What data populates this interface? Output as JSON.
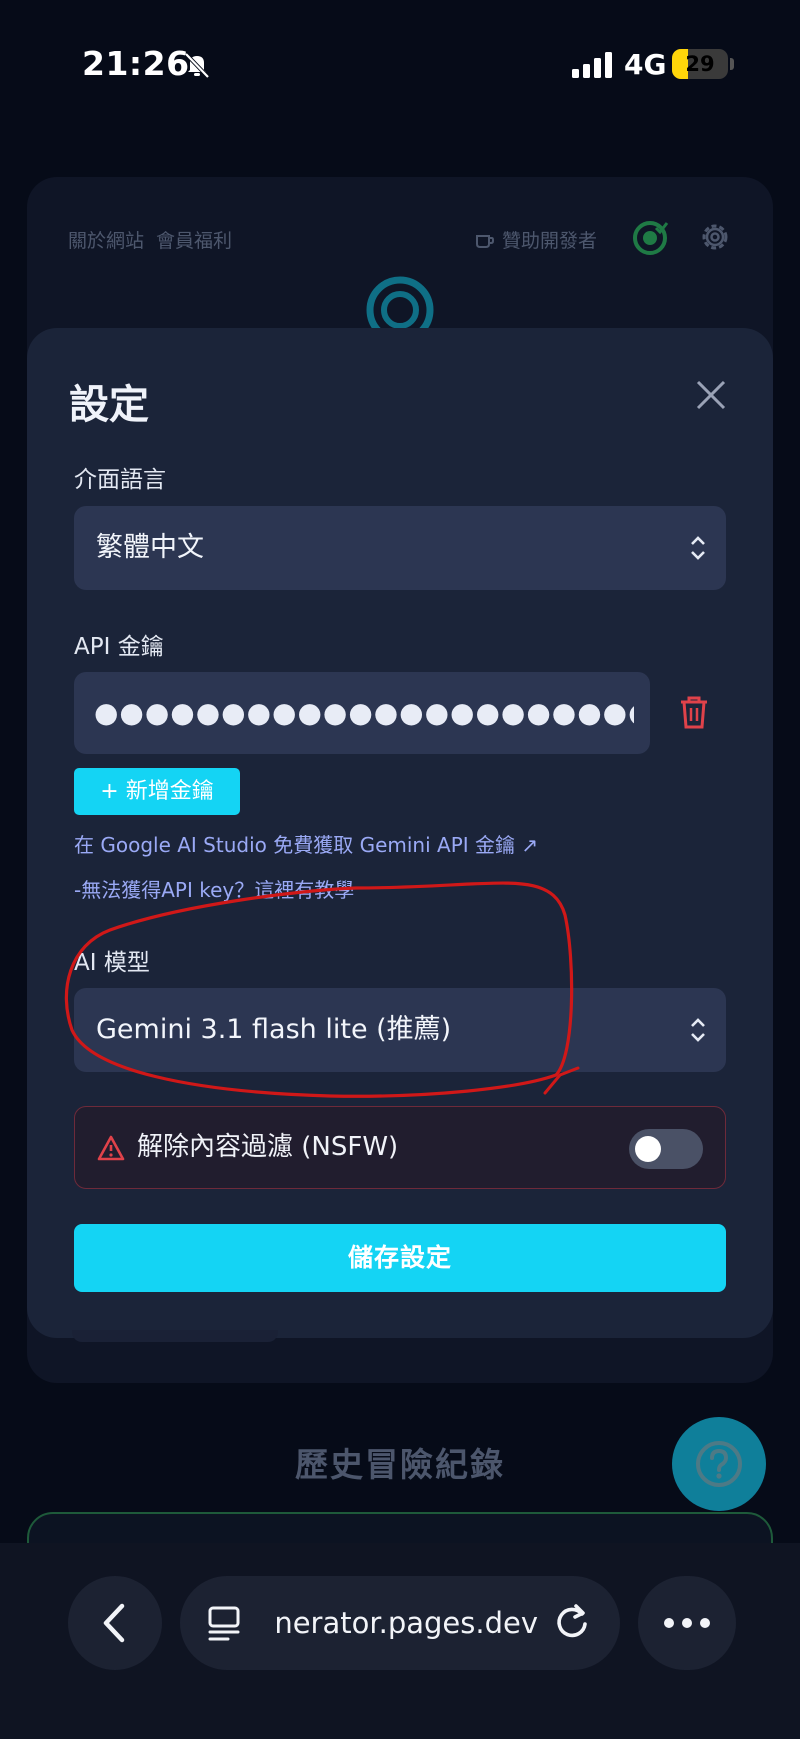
{
  "status_bar": {
    "time": "21:26",
    "network": "4G",
    "battery_level": "29",
    "battery_fraction": 0.29,
    "icons": [
      "bell-off-icon",
      "signal-icon"
    ]
  },
  "background_page": {
    "nav_links": [
      "關於網站",
      "會員福利"
    ],
    "sponsor_label": "贊助開發者",
    "history_title": "歷史冒險紀錄"
  },
  "settings": {
    "title": "設定",
    "language": {
      "label": "介面語言",
      "value": "繁體中文"
    },
    "api_key": {
      "label": "API 金鑰",
      "masked_value": "●●●●●●●●●●●●●●●●●●●●●●●●●●●●●●●●",
      "add_button": "+ 新增金鑰",
      "studio_link": "在 Google AI Studio 免費獲取 Gemini API 金鑰 ↗",
      "tutorial_link": "-無法獲得API key？這裡有教學"
    },
    "model": {
      "label": "AI 模型",
      "value": "Gemini 3.1 flash lite (推薦)"
    },
    "nsfw": {
      "label": "解除內容過濾 (NSFW)",
      "enabled": false
    },
    "save_button": "儲存設定"
  },
  "browser": {
    "url": "nerator.pages.dev"
  },
  "colors": {
    "accent": "#14d4f4",
    "modal_bg": "#1b2439",
    "input_bg": "#2c3652",
    "danger": "#e0424a",
    "annotation": "#d01818"
  }
}
